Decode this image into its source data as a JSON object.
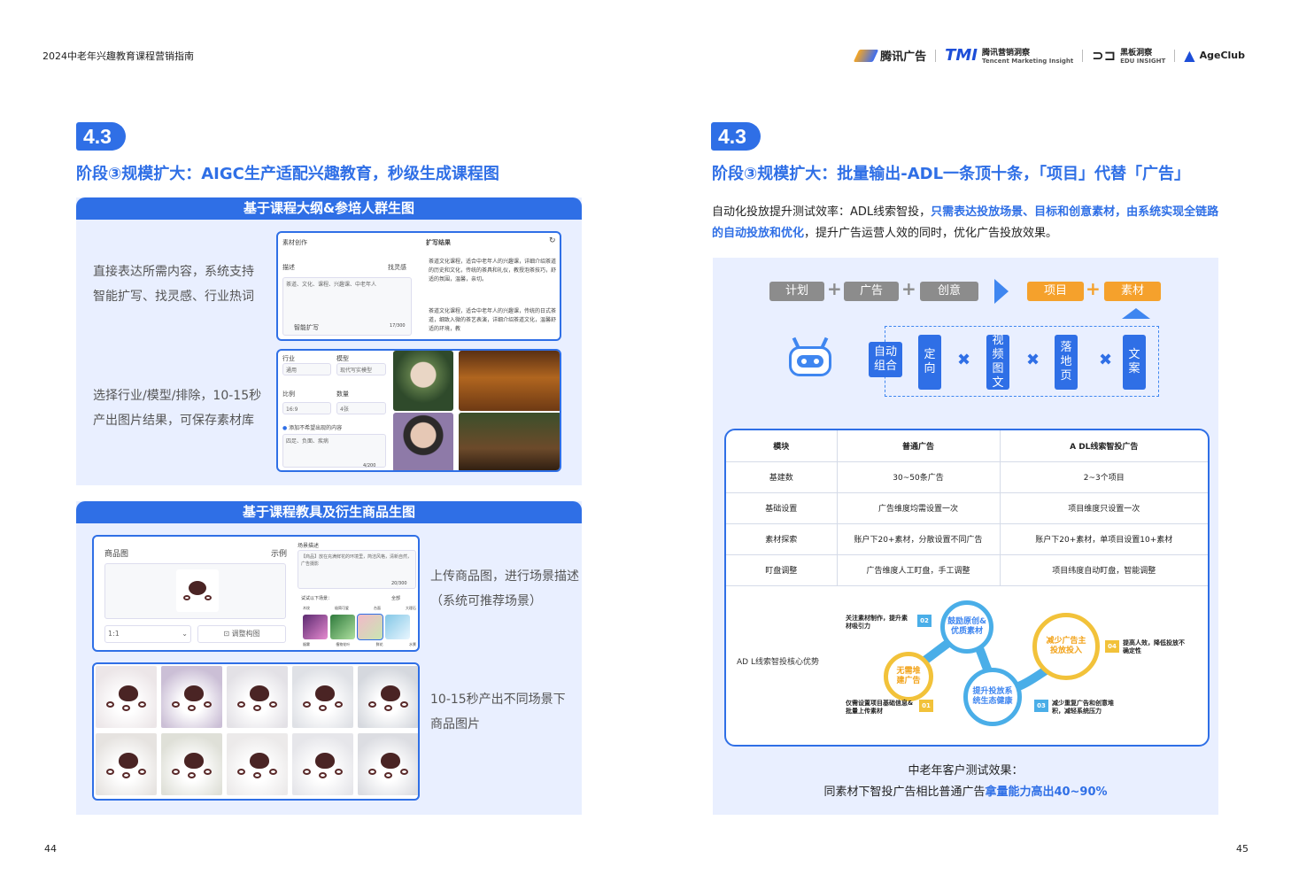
{
  "header": {
    "doc_title": "2024中老年兴趣教育课程营销指南",
    "logos": [
      "腾讯广告",
      "TMI",
      "腾讯营销洞察",
      "Tencent Marketing Insight",
      "黑板洞察",
      "EDU INSIGHT",
      "AgeClub"
    ]
  },
  "left": {
    "badge": "4.3",
    "heading": "阶段③规模扩大：AIGC生产适配兴趣教育，秒级生成课程图",
    "panel1": {
      "title": "基于课程大纲&参培人群生图",
      "text1": [
        "直接表达所需内容，系统支持",
        "智能扩写、找灵感、行业热词"
      ],
      "text2": [
        "选择行业/模型/排除，10-15秒",
        "产出图片结果，可保存素材库"
      ],
      "ui_top": {
        "tab1": "素材创作",
        "tab2": "扩写结果",
        "desc_label": "描述",
        "inspire": "找灵感",
        "desc_value": "茶道、文化、课程、兴趣课、中老年人",
        "smart_expand": "智能扩写",
        "counter": "17/300",
        "result1": "茶道文化课程，适合中老年人的兴趣课，详细介绍茶道的历史和文化，传统的茶具和礼仪，教授泡茶技巧，舒适的氛围，温馨，亲切。",
        "result2": "茶道文化课程，适合中老年人的兴趣课，传统的日式茶道，细致入微的茶艺表演，详细介绍茶道文化，温馨舒适的环境，教"
      },
      "ui_bottom": {
        "industry": "行业",
        "industry_value": "通用",
        "model": "模型",
        "model_value": "现代写实模型",
        "ratio": "比例",
        "ratio_value": "16:9",
        "count": "数量",
        "count_value": "4张",
        "exclude": "添加不希望出现的内容",
        "exclude_value": "四足、负面、疾病",
        "counter": "4/200"
      }
    },
    "panel2": {
      "title": "基于课程教具及衍生商品生图",
      "text1": [
        "上传商品图，进行场景描述",
        "（系统可推荐场景）"
      ],
      "text2": [
        "10-15秒产出不同场景下",
        "商品图片"
      ],
      "ui": {
        "product_label": "商品图",
        "example": "示例",
        "ratio_value": "1:1",
        "adjust": "调整构图",
        "scene_label": "场景描述",
        "scene_value": "【商品】放在充满鲜花的环境里，简洁风格，清新自然，广告摄影",
        "scene_counter": "20/300",
        "try_label": "试试以下场景：",
        "all": "全部",
        "scene_tags": [
          "木纹",
          "极简可爱",
          "台面",
          "大理石"
        ],
        "scene_tags2": [
          "烟雾",
          "植物花叶",
          "鲜花",
          "水景"
        ]
      }
    }
  },
  "right": {
    "badge": "4.3",
    "heading": "阶段③规模扩大：批量输出-ADL一条顶十条，「项目」代替「广告」",
    "para_plain1": "自动化投放提升测试效率：ADL线索智投，",
    "para_hl": "只需表达投放场景、目标和创意素材，由系统实现全链路的自动投放和优化",
    "para_plain2": "，提升广告运营人效的同时，优化广告投放效果。",
    "flow": {
      "gray_items": [
        "计划",
        "广告",
        "创意"
      ],
      "orange_items": [
        "项目",
        "素材"
      ],
      "blue_items": [
        "自动组合",
        "定向",
        "视频图文",
        "落地页",
        "文案"
      ]
    },
    "table": {
      "headers": [
        "模块",
        "普通广告",
        "A DL线索智投广告"
      ],
      "rows": [
        [
          "基建数",
          "30~50条广告",
          "2~3个项目"
        ],
        [
          "基础设置",
          "广告维度均需设置一次",
          "项目维度只设置一次"
        ],
        [
          "素材探索",
          "账户下20+素材，分散设置不同广告",
          "账户下20+素材，单项目设置10+素材"
        ],
        [
          "盯盘调整",
          "广告维度人工盯盘，手工调整",
          "项目纬度自动盯盘，智能调整"
        ]
      ],
      "advantage_label": "AD L线索智投核心优势"
    },
    "advantages": {
      "b1": "无需堆建广告",
      "b2": "鼓励原创&优质素材",
      "b3": "提升投放系统生态健康",
      "b4": "减少广告主投放投入",
      "n1": "01",
      "n2": "02",
      "n3": "03",
      "n4": "04",
      "note1": "仅需设置项目基础信息&批量上传素材",
      "note2": "关注素材制作，提升素材吸引力",
      "note3": "减少重复广告和创意堆积，减轻系统压力",
      "note4": "提高人效，降低投放不确定性"
    },
    "footer_line1": "中老年客户测试效果：",
    "footer_plain": "同素材下智投广告相比普通广告",
    "footer_hl": "拿量能力高出40~90%"
  },
  "page_numbers": {
    "left": "44",
    "right": "45"
  },
  "colors": {
    "brand_blue": "#2f6fe6",
    "panel_bg": "#e9efff",
    "orange": "#f5a12c",
    "gray": "#8c8c8c",
    "yellow": "#f2c23a",
    "sky": "#4aaee8"
  }
}
